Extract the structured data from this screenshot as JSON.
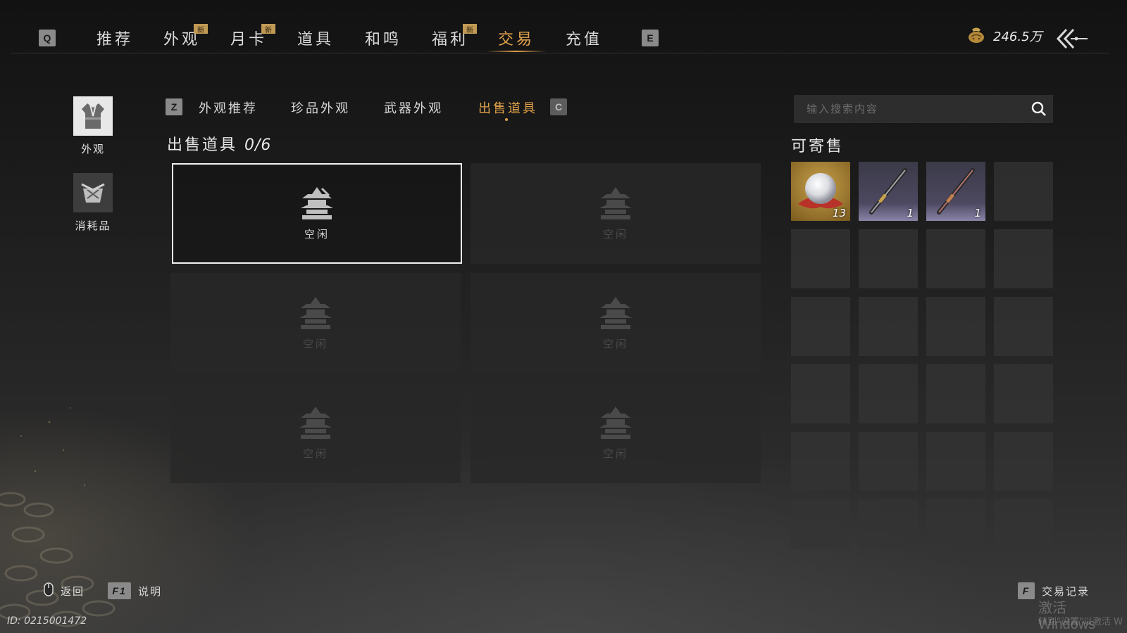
{
  "nav": {
    "prev_key": "Q",
    "next_key": "E",
    "tabs": [
      {
        "label": "推荐",
        "badge": ""
      },
      {
        "label": "外观",
        "badge": "新"
      },
      {
        "label": "月卡",
        "badge": "新"
      },
      {
        "label": "道具",
        "badge": ""
      },
      {
        "label": "和鸣",
        "badge": ""
      },
      {
        "label": "福利",
        "badge": "新"
      },
      {
        "label": "交易",
        "badge": "",
        "active": true
      },
      {
        "label": "充值",
        "badge": ""
      }
    ],
    "currency_value": "246.5万",
    "currency_icon": "coin-pouch-icon",
    "back_icon": "back-arrow-icon"
  },
  "categories": [
    {
      "label": "外观",
      "icon": "outfit-icon",
      "active": true
    },
    {
      "label": "消耗品",
      "icon": "consumable-icon",
      "active": false
    }
  ],
  "subtabs": {
    "prev_key": "Z",
    "next_key": "C",
    "items": [
      {
        "label": "外观推荐"
      },
      {
        "label": "珍品外观"
      },
      {
        "label": "武器外观"
      },
      {
        "label": "出售道具",
        "active": true
      }
    ]
  },
  "sell": {
    "title": "出售道具",
    "count": "0/6",
    "slot_label": "空闲",
    "slots": [
      {
        "label": "空闲",
        "selected": true
      },
      {
        "label": "空闲"
      },
      {
        "label": "空闲"
      },
      {
        "label": "空闲"
      },
      {
        "label": "空闲"
      },
      {
        "label": "空闲"
      }
    ]
  },
  "search": {
    "placeholder": "输入搜索内容",
    "icon": "search-icon"
  },
  "consignable": {
    "title": "可寄售",
    "items": [
      {
        "icon": "pearl-icon",
        "qty": "13",
        "rarity": "gold"
      },
      {
        "icon": "flute-weapon-icon",
        "qty": "1",
        "rarity": "purple"
      },
      {
        "icon": "flute-weapon-icon",
        "qty": "1",
        "rarity": "purple"
      }
    ],
    "total_cells": 24
  },
  "footer": {
    "back_label": "返回",
    "help_key": "F1",
    "help_label": "说明",
    "record_key": "F",
    "record_label": "交易记录",
    "id_text": "ID: 0215001472",
    "watermark_line1": "激活 Windows",
    "watermark_line2": "转到\"设置\"以激活 W"
  }
}
